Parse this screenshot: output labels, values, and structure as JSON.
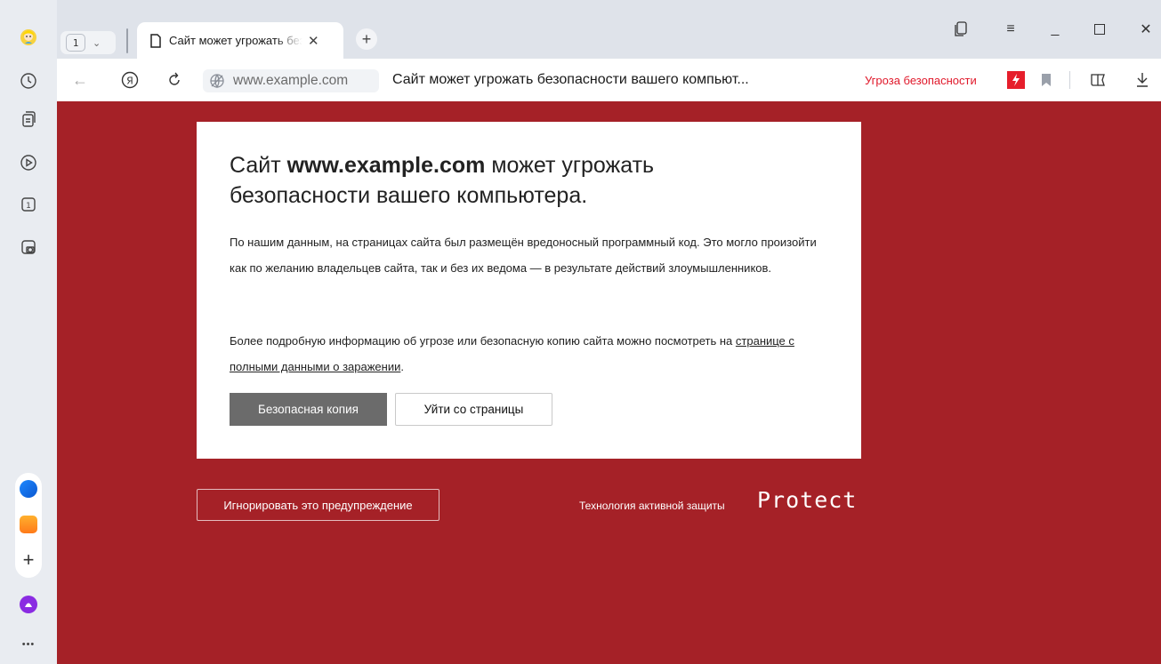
{
  "browser": {
    "tab_count": "1",
    "tab_title": "Сайт может угрожать безопасности вашего компьютера",
    "new_tab_symbol": "+",
    "window_controls": [
      "minimize-icon",
      "maximize-icon",
      "close-icon"
    ]
  },
  "sidebar": {
    "items": [
      "history-icon",
      "collections-icon",
      "video-icon",
      "tabs-icon",
      "screenshot-icon"
    ],
    "apps": [
      "yandex-browser-app-icon",
      "mail-app-icon"
    ],
    "add_symbol": "+",
    "alice": "alice-icon",
    "more_symbol": "•••"
  },
  "addressbar": {
    "host": "www.example.com",
    "page_title": "Сайт может угрожать безопасности вашего компьют...",
    "threat_label": "Угроза безопасности"
  },
  "warning": {
    "headline_prefix": "Сайт ",
    "headline_host": "www.example.com",
    "headline_line1_rest": " может угрожать",
    "headline_line2": "безопасности вашего компьютера.",
    "paragraph1": "По нашим данным, на страницах сайта был размещён вредоносный программный код. Это могло произойти как по желанию владельцев сайта, так и без их ведома — в результате действий злоумышленников.",
    "paragraph2_prefix": "Более подробную информацию об угрозе или безопасную копию сайта можно посмотреть на ",
    "paragraph2_link": "странице с полными данными о заражении",
    "paragraph2_suffix": ".",
    "safe_copy_button": "Безопасная копия",
    "leave_button": "Уйти со страницы",
    "ignore_button": "Игнорировать это предупреждение",
    "technology_label": "Технология активной защиты",
    "protect_logo": "Protect"
  },
  "colors": {
    "page_background": "#a52127",
    "threat_red": "#e0182a",
    "safe_button": "#6b6b6b"
  }
}
